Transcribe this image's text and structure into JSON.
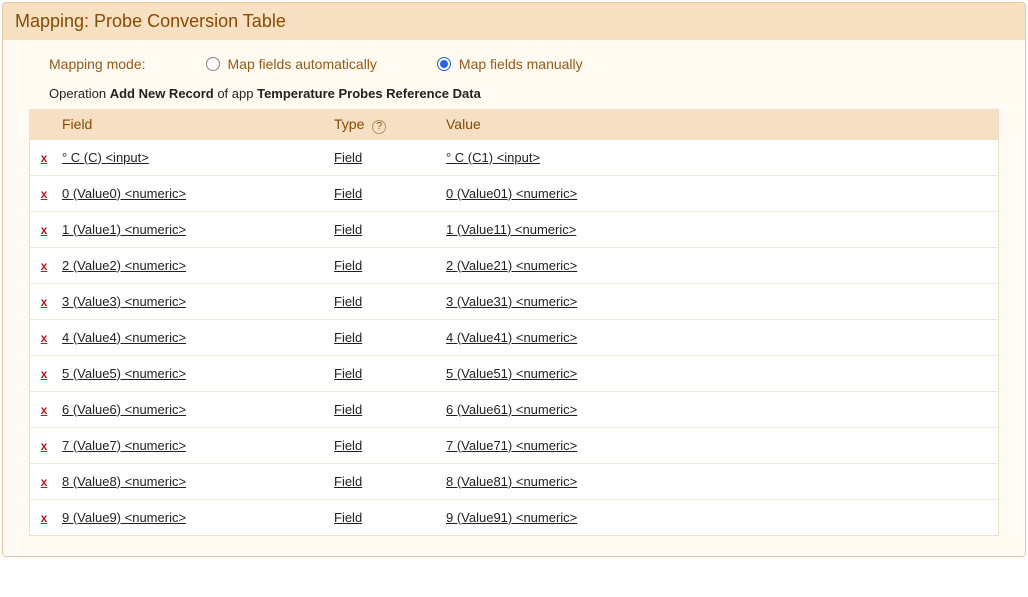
{
  "header": {
    "title": "Mapping: Probe Conversion Table"
  },
  "mapping_mode": {
    "label": "Mapping mode:",
    "auto_label": "Map fields automatically",
    "manual_label": "Map fields manually",
    "selected": "manual"
  },
  "operation": {
    "prefix": "Operation ",
    "action": "Add New Record",
    "middle": " of app ",
    "app": "Temperature Probes Reference Data"
  },
  "columns": {
    "field": "Field",
    "type": "Type",
    "value": "Value",
    "help": "?"
  },
  "delete_glyph": "x",
  "rows": [
    {
      "field": "° C (C) <input>",
      "type": "Field",
      "value": "° C (C1) <input>"
    },
    {
      "field": "0 (Value0) <numeric>",
      "type": "Field",
      "value": "0 (Value01) <numeric>"
    },
    {
      "field": "1 (Value1) <numeric>",
      "type": "Field",
      "value": "1 (Value11) <numeric>"
    },
    {
      "field": "2 (Value2) <numeric>",
      "type": "Field",
      "value": "2 (Value21) <numeric>"
    },
    {
      "field": "3 (Value3) <numeric>",
      "type": "Field",
      "value": "3 (Value31) <numeric>"
    },
    {
      "field": "4 (Value4) <numeric>",
      "type": "Field",
      "value": "4 (Value41) <numeric>"
    },
    {
      "field": "5 (Value5) <numeric>",
      "type": "Field",
      "value": "5 (Value51) <numeric>"
    },
    {
      "field": "6 (Value6) <numeric>",
      "type": "Field",
      "value": "6 (Value61) <numeric>"
    },
    {
      "field": "7 (Value7) <numeric>",
      "type": "Field",
      "value": "7 (Value71) <numeric>"
    },
    {
      "field": "8 (Value8) <numeric>",
      "type": "Field",
      "value": "8 (Value81) <numeric>"
    },
    {
      "field": "9 (Value9) <numeric>",
      "type": "Field",
      "value": "9 (Value91) <numeric>"
    }
  ]
}
